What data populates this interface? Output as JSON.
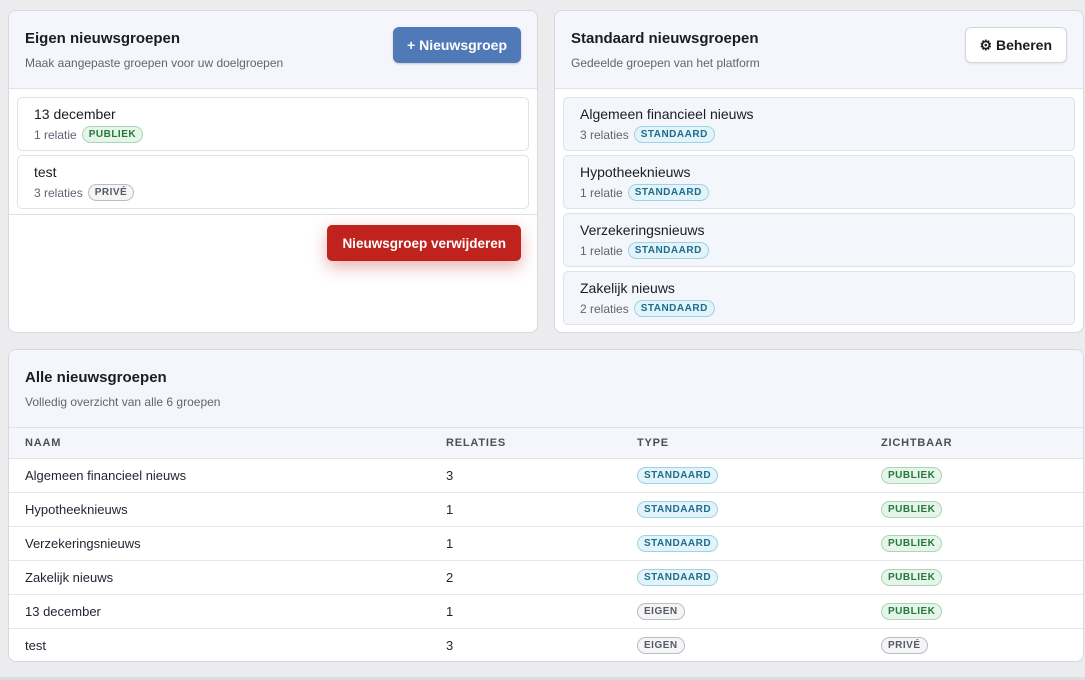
{
  "own": {
    "title": "Eigen nieuwsgroepen",
    "subtitle": "Maak aangepaste groepen voor uw doelgroepen",
    "new_button": "+ Nieuwsgroep",
    "items": [
      {
        "name": "13 december",
        "relations": "1 relatie",
        "badge": "PUBLIEK"
      },
      {
        "name": "test",
        "relations": "3 relaties",
        "badge": "PRIVÉ"
      }
    ],
    "delete_button": "Nieuwsgroep verwijderen"
  },
  "standard": {
    "title": "Standaard nieuwsgroepen",
    "subtitle": "Gedeelde groepen van het platform",
    "manage_button": "⚙ Beheren",
    "items": [
      {
        "name": "Algemeen financieel nieuws",
        "relations": "3 relaties",
        "badge": "STANDAARD"
      },
      {
        "name": "Hypotheeknieuws",
        "relations": "1 relatie",
        "badge": "STANDAARD"
      },
      {
        "name": "Verzekeringsnieuws",
        "relations": "1 relatie",
        "badge": "STANDAARD"
      },
      {
        "name": "Zakelijk nieuws",
        "relations": "2 relaties",
        "badge": "STANDAARD"
      }
    ]
  },
  "all": {
    "title": "Alle nieuwsgroepen",
    "subtitle": "Volledig overzicht van alle 6 groepen",
    "columns": [
      "NAAM",
      "RELATIES",
      "TYPE",
      "ZICHTBAAR"
    ],
    "rows": [
      {
        "name": "Algemeen financieel nieuws",
        "relations": "3",
        "type": "STANDAARD",
        "visible": "PUBLIEK"
      },
      {
        "name": "Hypotheeknieuws",
        "relations": "1",
        "type": "STANDAARD",
        "visible": "PUBLIEK"
      },
      {
        "name": "Verzekeringsnieuws",
        "relations": "1",
        "type": "STANDAARD",
        "visible": "PUBLIEK"
      },
      {
        "name": "Zakelijk nieuws",
        "relations": "2",
        "type": "STANDAARD",
        "visible": "PUBLIEK"
      },
      {
        "name": "13 december",
        "relations": "1",
        "type": "EIGEN",
        "visible": "PUBLIEK"
      },
      {
        "name": "test",
        "relations": "3",
        "type": "EIGEN",
        "visible": "PRIVÉ"
      }
    ]
  },
  "colors": {
    "primary": "#5079b8",
    "danger": "#c0231e",
    "public": "#237a3a",
    "standard": "#1d6d8c"
  }
}
